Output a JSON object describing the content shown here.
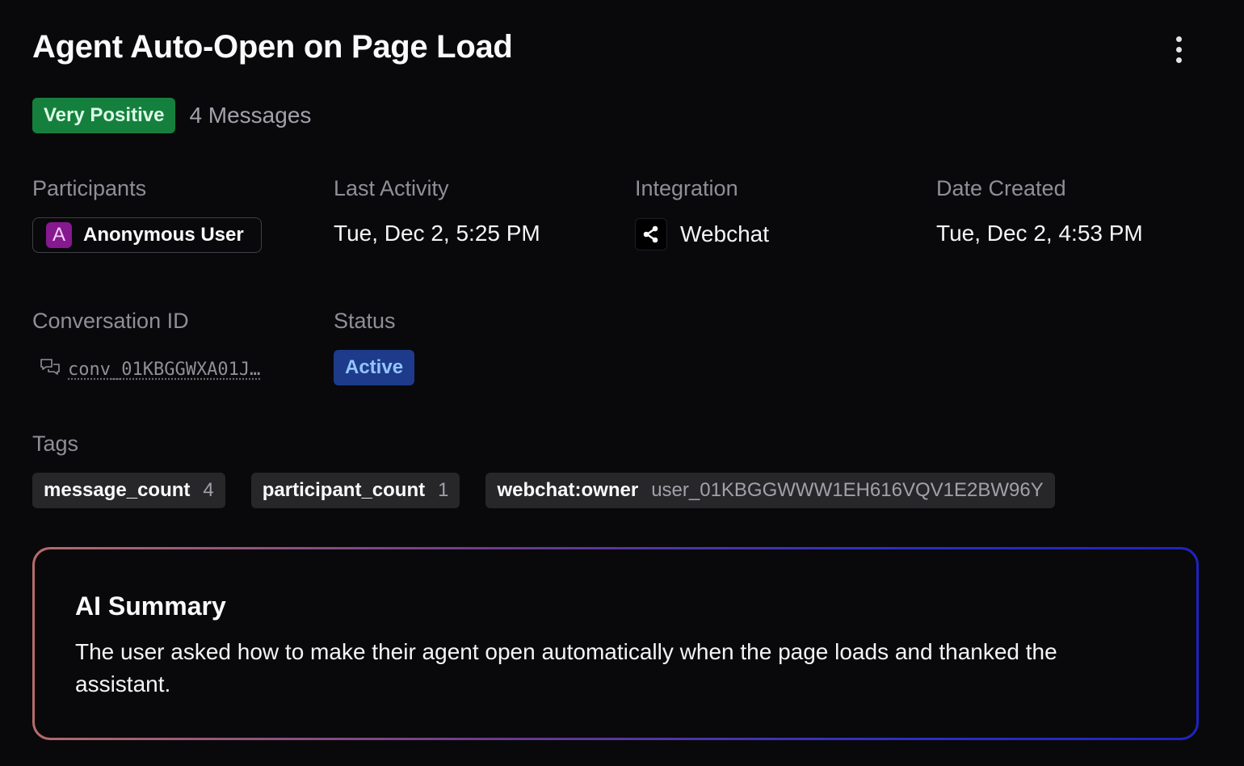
{
  "header": {
    "title": "Agent Auto-Open on Page Load",
    "menu_icon": "more-vertical-icon"
  },
  "meta": {
    "sentiment": "Very Positive",
    "sentiment_color": "#15803d",
    "message_count": "4 Messages"
  },
  "details": {
    "participants_label": "Participants",
    "participant": {
      "avatar_letter": "A",
      "name": "Anonymous User",
      "avatar_color": "#86198f"
    },
    "last_activity_label": "Last Activity",
    "last_activity": "Tue, Dec 2, 5:25 PM",
    "integration_label": "Integration",
    "integration": {
      "icon": "share-nodes-icon",
      "name": "Webchat"
    },
    "date_created_label": "Date Created",
    "date_created": "Tue, Dec 2, 4:53 PM",
    "conversation_id_label": "Conversation ID",
    "conversation_id": "conv_01KBGGWXA01J…",
    "status_label": "Status",
    "status": "Active",
    "status_color": "#1e3a8a"
  },
  "tags": {
    "label": "Tags",
    "items": [
      {
        "key": "message_count",
        "value": "4"
      },
      {
        "key": "participant_count",
        "value": "1"
      },
      {
        "key": "webchat:owner",
        "value": "user_01KBGGWWW1EH616VQV1E2BW96Y"
      }
    ]
  },
  "summary": {
    "title": "AI Summary",
    "text": "The user asked how to make their agent open automatically when the page loads and thanked the assistant."
  }
}
